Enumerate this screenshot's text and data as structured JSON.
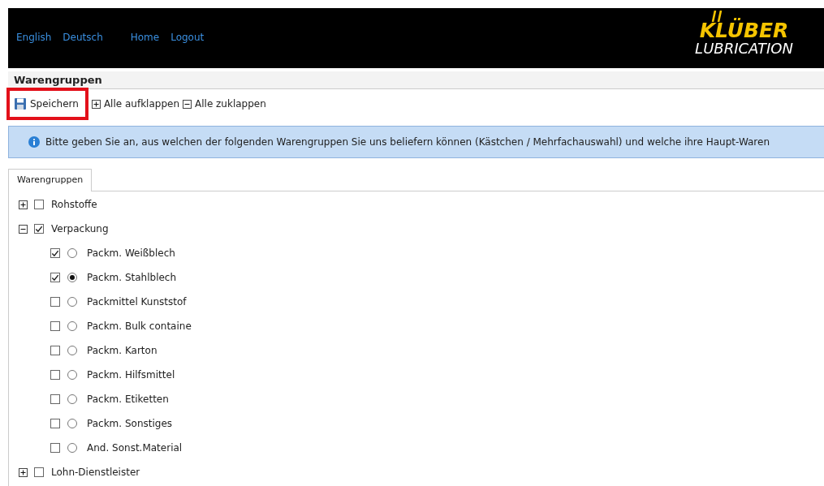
{
  "header": {
    "nav": [
      {
        "label": "English",
        "kind": "language"
      },
      {
        "label": "Deutsch",
        "kind": "language"
      },
      {
        "label": "Home",
        "kind": "page"
      },
      {
        "label": "Logout",
        "kind": "page"
      }
    ],
    "logo": {
      "brand": "KLÜBER",
      "sub": "LUBRICATION"
    }
  },
  "panel_title": "Warengruppen",
  "toolbar": [
    {
      "label": "Speichern",
      "kind": "save",
      "highlighted": true
    },
    {
      "label": "Alle aufklappen",
      "kind": "expand",
      "highlighted": false
    },
    {
      "label": "Alle zuklappen",
      "kind": "collapse",
      "highlighted": false
    }
  ],
  "info": "Bitte geben Sie an, aus welchen der folgenden Warengruppen Sie uns beliefern können (Kästchen / Mehrfachauswahl) und welche ihre Haupt-Waren",
  "tabs": [
    {
      "label": "Warengruppen",
      "selected": true
    }
  ],
  "tree": [
    {
      "label": "Rohstoffe",
      "expanded": false,
      "checked": false
    },
    {
      "label": "Verpackung",
      "expanded": true,
      "checked": true,
      "children": [
        {
          "label": "Packm. Weißblech",
          "checked": true,
          "selected": false
        },
        {
          "label": "Packm. Stahlblech",
          "checked": true,
          "selected": true
        },
        {
          "label": "Packmittel Kunststof",
          "checked": false,
          "selected": false
        },
        {
          "label": "Packm. Bulk containe",
          "checked": false,
          "selected": false
        },
        {
          "label": "Packm. Karton",
          "checked": false,
          "selected": false
        },
        {
          "label": "Packm. Hilfsmittel",
          "checked": false,
          "selected": false
        },
        {
          "label": "Packm. Etiketten",
          "checked": false,
          "selected": false
        },
        {
          "label": "Packm. Sonstiges",
          "checked": false,
          "selected": false
        },
        {
          "label": "And. Sonst.Material",
          "checked": false,
          "selected": false
        }
      ]
    },
    {
      "label": "Lohn-Dienstleister",
      "expanded": false,
      "checked": false
    }
  ]
}
